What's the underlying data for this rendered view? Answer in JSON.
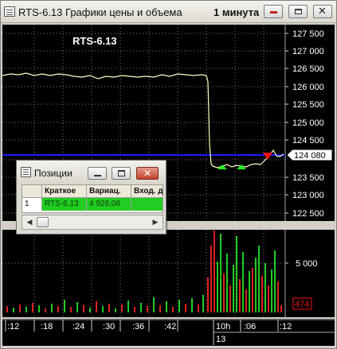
{
  "window": {
    "title": "RTS-6.13 Графики цены и объема",
    "timeframe": "1 минута",
    "close_glyph": "✕"
  },
  "price_chart": {
    "instrument_label": "RTS-6.13",
    "current_price_label": "124 080",
    "price_ticks": [
      "127 500",
      "127 000",
      "126 500",
      "126 000",
      "125 500",
      "125 000",
      "124 500",
      "124 000",
      "123 500",
      "123 000",
      "122 500"
    ],
    "colors": {
      "price_line": "#ffffc0",
      "horizontal_level": "#1c1cff",
      "marker_up": "#22ee22",
      "marker_down": "#ee1111",
      "grid": "#777777"
    }
  },
  "volume_chart": {
    "volume_tick": "5 000",
    "current_volume_label": "474",
    "colors": {
      "up": "#22cc22",
      "down": "#dd2222"
    }
  },
  "time_axis": {
    "labels": [
      ":12",
      ":18",
      ":24",
      ":30",
      ":36",
      ":42",
      "10h",
      ":06",
      ":12"
    ],
    "date_label": "13"
  },
  "positions_window": {
    "title": "Позиции",
    "close_glyph": "✕",
    "columns": [
      "",
      "Краткое",
      "Вариац.",
      "Вход. д"
    ],
    "rows": [
      {
        "index": "1",
        "short_name": "RTS-6.13",
        "variation": "4 928,08",
        "entry": ""
      }
    ],
    "scroll_left_glyph": "◀",
    "scroll_right_glyph": "▶"
  }
}
